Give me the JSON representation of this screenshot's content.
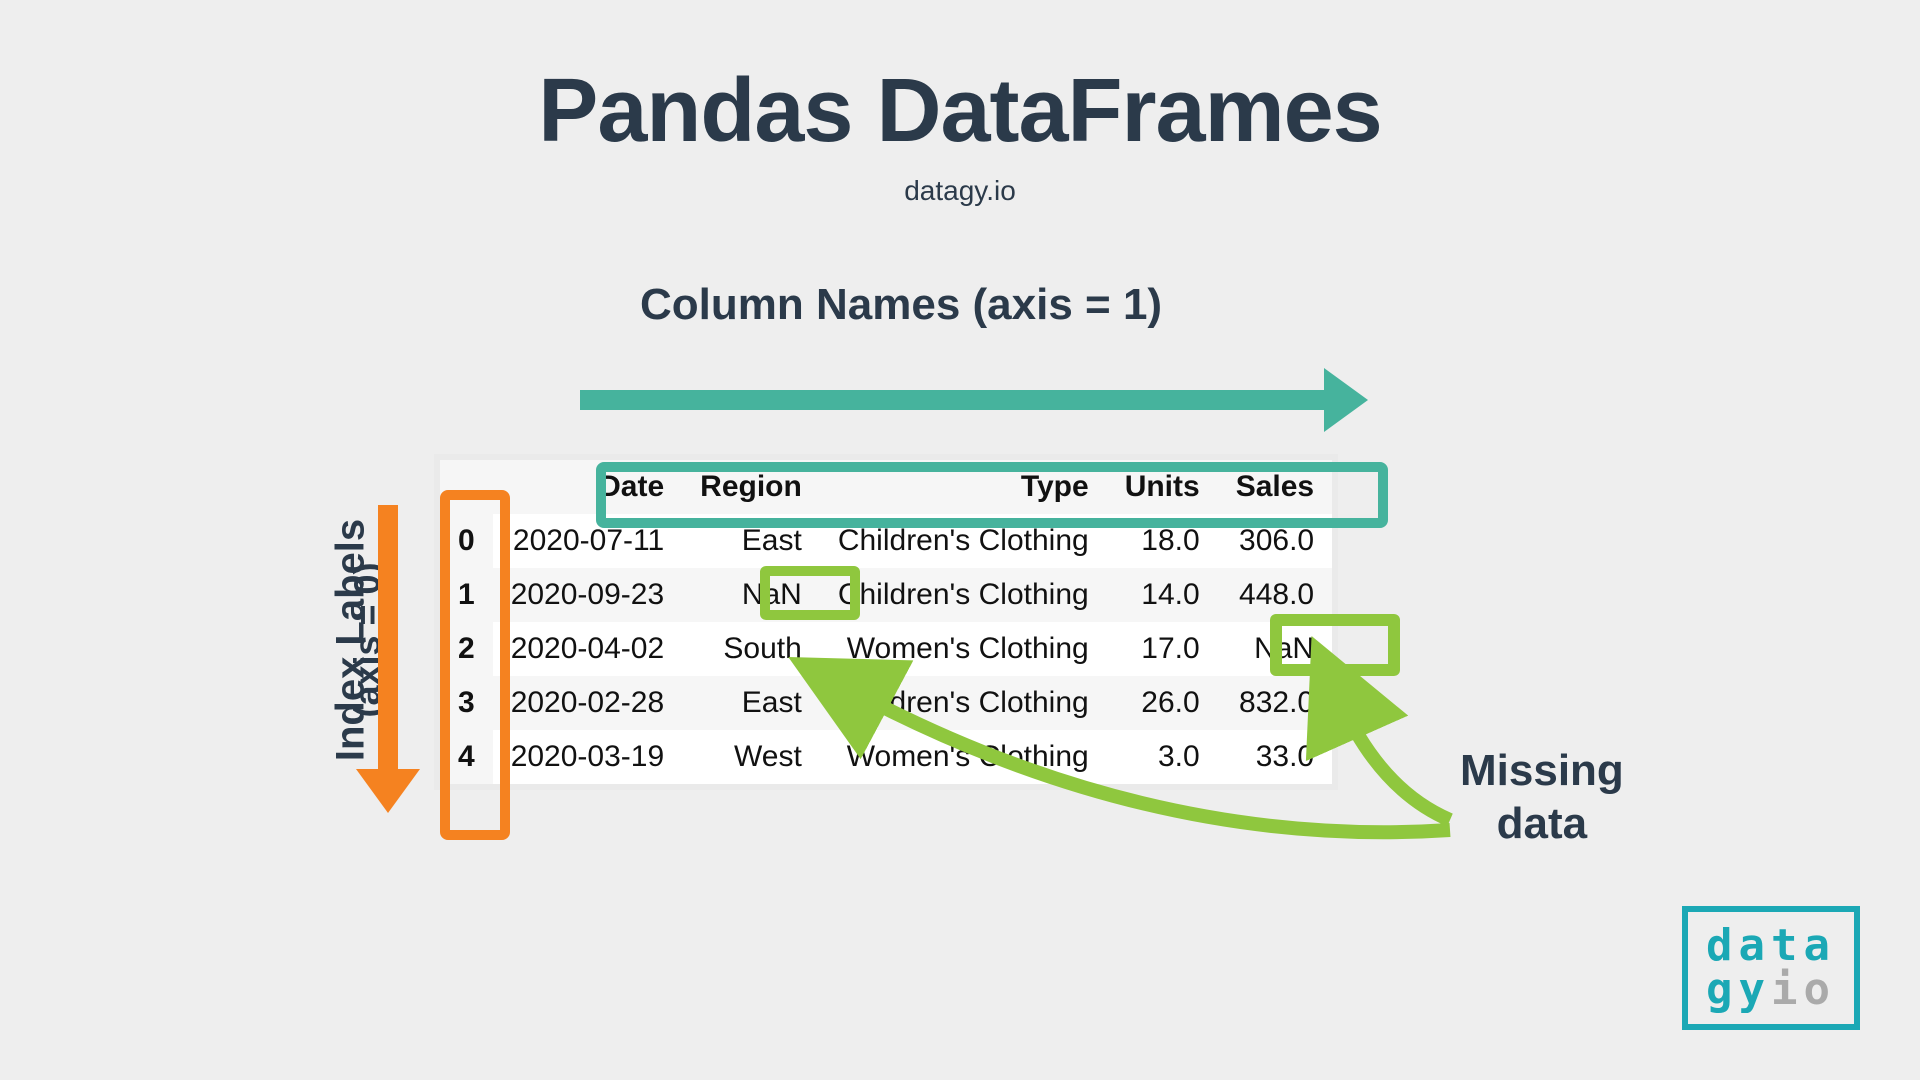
{
  "title": "Pandas DataFrames",
  "subtitle": "datagy.io",
  "labels": {
    "columns": "Column Names (axis = 1)",
    "index": "Index Labels",
    "index_sub": "(axis = 0)",
    "missing_line1": "Missing",
    "missing_line2": "data"
  },
  "table": {
    "headers": [
      "Date",
      "Region",
      "Type",
      "Units",
      "Sales"
    ],
    "rows": [
      {
        "idx": "0",
        "date": "2020-07-11",
        "region": "East",
        "type": "Children's Clothing",
        "units": "18.0",
        "sales": "306.0"
      },
      {
        "idx": "1",
        "date": "2020-09-23",
        "region": "NaN",
        "type": "Children's Clothing",
        "units": "14.0",
        "sales": "448.0"
      },
      {
        "idx": "2",
        "date": "2020-04-02",
        "region": "South",
        "type": "Women's Clothing",
        "units": "17.0",
        "sales": "NaN"
      },
      {
        "idx": "3",
        "date": "2020-02-28",
        "region": "East",
        "type": "Children's Clothing",
        "units": "26.0",
        "sales": "832.0"
      },
      {
        "idx": "4",
        "date": "2020-03-19",
        "region": "West",
        "type": "Women's Clothing",
        "units": "3.0",
        "sales": "33.0"
      }
    ]
  },
  "logo": {
    "line1": "data",
    "line2a": "gy",
    "line2b": "io"
  }
}
